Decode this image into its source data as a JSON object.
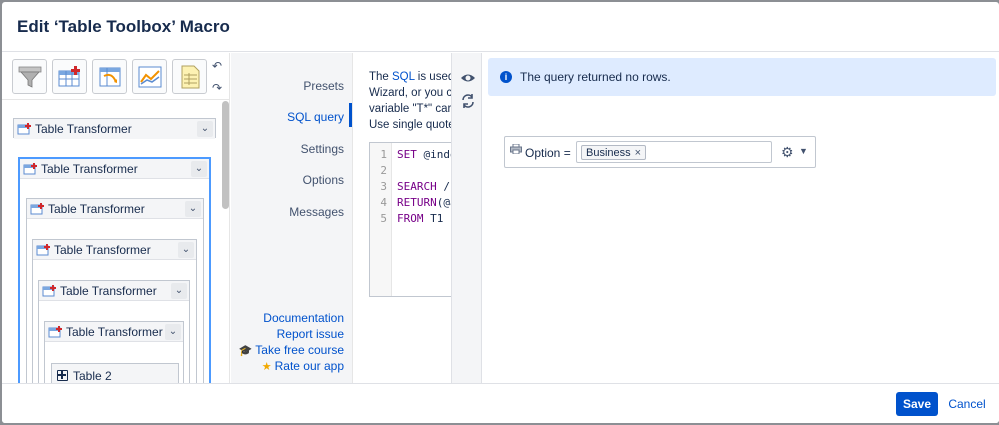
{
  "dialog": {
    "title": "Edit ‘Table Toolbox’ Macro"
  },
  "toolbox": {
    "tools": [
      {
        "icon": "filter-funnel-icon"
      },
      {
        "icon": "table-add-row-icon"
      },
      {
        "icon": "table-pivot-icon"
      },
      {
        "icon": "line-chart-icon"
      },
      {
        "icon": "spreadsheet-icon"
      }
    ],
    "undo_icon": "undo-icon",
    "redo_icon": "redo-icon",
    "tree": [
      {
        "label": "Table Transformer"
      },
      {
        "label": "Table Transformer"
      },
      {
        "label": "Table Transformer"
      },
      {
        "label": "Table Transformer"
      },
      {
        "label": "Table Transformer"
      },
      {
        "label": "Table Transformer"
      }
    ],
    "table_label": "Table 2"
  },
  "nav": {
    "items": [
      "Presets",
      "SQL query",
      "Settings",
      "Options",
      "Messages"
    ],
    "active": "SQL query",
    "links": {
      "documentation": "Documentation",
      "report_issue": "Report issue",
      "free_course": "Take free course",
      "rate_app": "Rate our app"
    }
  },
  "sql": {
    "desc_line1_pre": "The ",
    "desc_line1_link": "SQL",
    "desc_line1_post": " is used",
    "desc_line2": "Wizard, or you c",
    "desc_line3": "variable \"T*\" car",
    "desc_line4": "Use single quote",
    "lines": [
      {
        "num": "1",
        "kw": "SET",
        "rest": " @inde"
      },
      {
        "num": "2",
        "kw": "",
        "rest": ""
      },
      {
        "num": "3",
        "kw": "SEARCH",
        "rest": " /"
      },
      {
        "num": "4",
        "kw": "RETURN",
        "rest": "(@a"
      },
      {
        "num": "5",
        "kw": "FROM",
        "rest": " T1"
      }
    ]
  },
  "strip": {
    "preview_icon": "eye-icon",
    "refresh_icon": "refresh-icon"
  },
  "preview": {
    "banner": "The query returned no rows.",
    "filter": {
      "label": "Option =",
      "tag": "Business",
      "remove_glyph": "×"
    }
  },
  "footer": {
    "save_label": "Save",
    "cancel_label": "Cancel"
  },
  "colors": {
    "accent": "#0052cc",
    "banner_bg": "#deebff",
    "nav_bg": "#f4f5f7"
  }
}
